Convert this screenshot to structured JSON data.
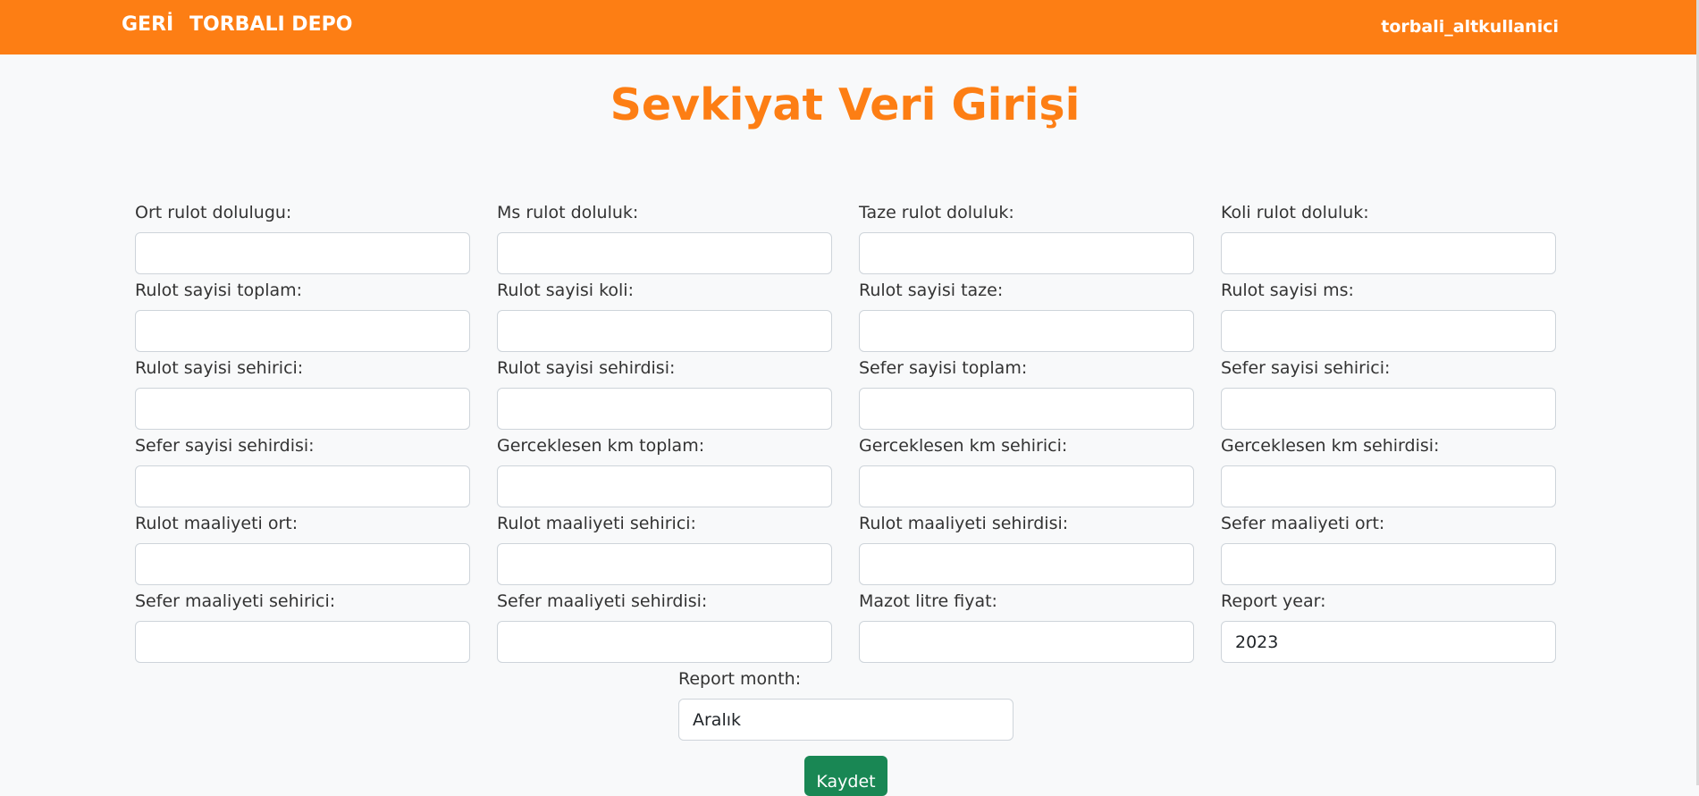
{
  "nav": {
    "back_label": "GERİ",
    "brand_label": "TORBALI DEPO",
    "user_label": "torbali_altkullanici"
  },
  "page_title": "Sevkiyat Veri Girişi",
  "fields": [
    {
      "label": "Ort rulot dolulugu:",
      "value": ""
    },
    {
      "label": "Ms rulot doluluk:",
      "value": ""
    },
    {
      "label": "Taze rulot doluluk:",
      "value": ""
    },
    {
      "label": "Koli rulot doluluk:",
      "value": ""
    },
    {
      "label": "Rulot sayisi toplam:",
      "value": ""
    },
    {
      "label": "Rulot sayisi koli:",
      "value": ""
    },
    {
      "label": "Rulot sayisi taze:",
      "value": ""
    },
    {
      "label": "Rulot sayisi ms:",
      "value": ""
    },
    {
      "label": "Rulot sayisi sehirici:",
      "value": ""
    },
    {
      "label": "Rulot sayisi sehirdisi:",
      "value": ""
    },
    {
      "label": "Sefer sayisi toplam:",
      "value": ""
    },
    {
      "label": "Sefer sayisi sehirici:",
      "value": ""
    },
    {
      "label": "Sefer sayisi sehirdisi:",
      "value": ""
    },
    {
      "label": "Gerceklesen km toplam:",
      "value": ""
    },
    {
      "label": "Gerceklesen km sehirici:",
      "value": ""
    },
    {
      "label": "Gerceklesen km sehirdisi:",
      "value": ""
    },
    {
      "label": "Rulot maaliyeti ort:",
      "value": ""
    },
    {
      "label": "Rulot maaliyeti sehirici:",
      "value": ""
    },
    {
      "label": "Rulot maaliyeti sehirdisi:",
      "value": ""
    },
    {
      "label": "Sefer maaliyeti ort:",
      "value": ""
    },
    {
      "label": "Sefer maaliyeti sehirici:",
      "value": ""
    },
    {
      "label": "Sefer maaliyeti sehirdisi:",
      "value": ""
    },
    {
      "label": "Mazot litre fiyat:",
      "value": ""
    },
    {
      "label": "Report year:",
      "value": "2023"
    }
  ],
  "report_month": {
    "label": "Report month:",
    "value": "Aralık"
  },
  "save_label": "Kaydet",
  "colors": {
    "accent": "#fd7e14",
    "save_button": "#198754",
    "background": "#f8f9fa"
  }
}
